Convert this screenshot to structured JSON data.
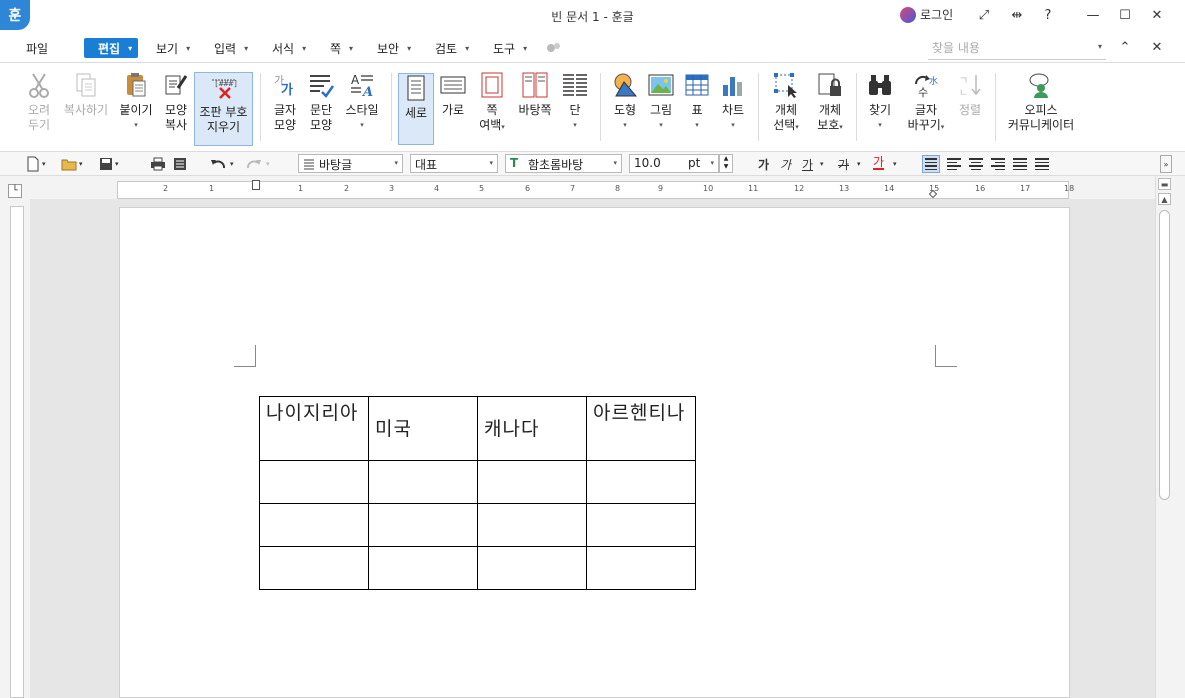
{
  "titlebar": {
    "app_logo": "훈",
    "title": "빈 문서 1 - 훈글",
    "login_label": "로그인",
    "controls": [
      "⤢",
      "⇹",
      "?",
      "—",
      "☐",
      "✕"
    ]
  },
  "menubar": {
    "items": [
      {
        "label": "파일",
        "active": false,
        "caret": ""
      },
      {
        "label": "편집",
        "active": true,
        "caret": "▾"
      },
      {
        "label": "보기",
        "active": false,
        "caret": "▾"
      },
      {
        "label": "입력",
        "active": false,
        "caret": "▾"
      },
      {
        "label": "서식",
        "active": false,
        "caret": "▾"
      },
      {
        "label": "쪽",
        "active": false,
        "caret": "▾"
      },
      {
        "label": "보안",
        "active": false,
        "caret": "▾"
      },
      {
        "label": "검토",
        "active": false,
        "caret": "▾"
      },
      {
        "label": "도구",
        "active": false,
        "caret": "▾"
      }
    ],
    "search_placeholder": "찾을 내용",
    "collapse_icon": "⌃",
    "close_icon": "✕"
  },
  "ribbon": {
    "cut": {
      "line1": "오려",
      "line2": "두기"
    },
    "copy": {
      "line1": "복사하기"
    },
    "paste": {
      "line1": "붙이기"
    },
    "format_copy": {
      "line1": "모양",
      "line2": "복사"
    },
    "clear_format": {
      "line1": "조판 부호",
      "line2": "지우기"
    },
    "char_shape": {
      "line1": "글자",
      "line2": "모양"
    },
    "para_shape": {
      "line1": "문단",
      "line2": "모양"
    },
    "style": {
      "line1": "스타일"
    },
    "portrait": {
      "line1": "세로"
    },
    "landscape": {
      "line1": "가로"
    },
    "page_margin": {
      "line1": "쪽",
      "line2": "여백"
    },
    "background": {
      "line1": "바탕쪽"
    },
    "columns": {
      "line1": "단"
    },
    "shape": {
      "line1": "도형"
    },
    "picture": {
      "line1": "그림"
    },
    "table": {
      "line1": "표"
    },
    "chart": {
      "line1": "차트"
    },
    "select_object": {
      "line1": "개체",
      "line2": "선택"
    },
    "protect_object": {
      "line1": "개체",
      "line2": "보호"
    },
    "find": {
      "line1": "찾기"
    },
    "replace": {
      "line1": "글자",
      "line2": "바꾸기"
    },
    "sort": {
      "line1": "정렬"
    },
    "office_community": {
      "line1": "오피스",
      "line2": "커뮤니케이터"
    }
  },
  "formatbar": {
    "style_combo": "바탕글",
    "lang_combo": "대표",
    "font_combo": "함초롬바탕",
    "size_value": "10.0",
    "size_unit": "pt",
    "bold": "가",
    "italic": "가",
    "underline": "가",
    "strike": "가",
    "color_char": "가"
  },
  "ruler": {
    "h_numbers": [
      "2",
      "1",
      "1",
      "2",
      "3",
      "4",
      "5",
      "6",
      "7",
      "8",
      "9",
      "10",
      "11",
      "12",
      "13",
      "14",
      "15",
      "16",
      "17",
      "18"
    ]
  },
  "table": {
    "header": [
      "나이지리아",
      "미국",
      "캐나다",
      "아르헨티나"
    ],
    "rows": [
      [
        "",
        "",
        "",
        ""
      ],
      [
        "",
        "",
        "",
        ""
      ],
      [
        "",
        "",
        "",
        ""
      ]
    ]
  }
}
